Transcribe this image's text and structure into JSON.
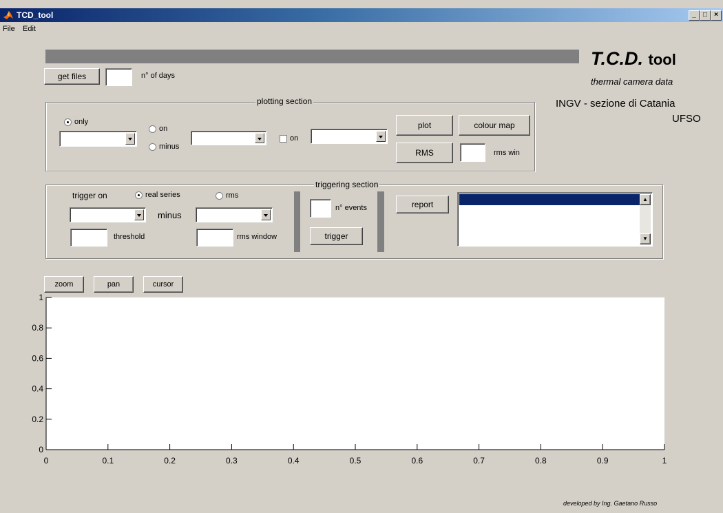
{
  "window": {
    "title": "TCD_tool"
  },
  "menu": {
    "file": "File",
    "edit": "Edit"
  },
  "brand": {
    "name_big": "T.C.D.",
    "name_small": "tool",
    "subtitle": "thermal camera data",
    "institute": "INGV - sezione di Catania",
    "unit": "UFSO",
    "footer": "developed by Ing. Gaetano Russo"
  },
  "files": {
    "get_files_label": "get files",
    "days_label": "n° of days",
    "days_value": ""
  },
  "plotting": {
    "title": "plotting section",
    "only_label": "only",
    "on_label": "on",
    "minus_label": "minus",
    "on2_label": "on",
    "plot_label": "plot",
    "colour_map_label": "colour map",
    "rms_label": "RMS",
    "rms_win_label": "rms win",
    "rms_win_value": ""
  },
  "triggering": {
    "title": "triggering section",
    "trigger_on_label": "trigger on",
    "real_series_label": "real series",
    "rms_label": "rms",
    "minus_label": "minus",
    "threshold_label": "threshold",
    "rms_window_label": "rms window",
    "n_events_label": "n° events",
    "trigger_label": "trigger",
    "report_label": "report"
  },
  "toolbar": {
    "zoom_label": "zoom",
    "pan_label": "pan",
    "cursor_label": "cursor"
  },
  "chart_data": {
    "type": "line",
    "xlim": [
      0,
      1
    ],
    "ylim": [
      0,
      1
    ],
    "x_ticks": [
      "0",
      "0.1",
      "0.2",
      "0.3",
      "0.4",
      "0.5",
      "0.6",
      "0.7",
      "0.8",
      "0.9",
      "1"
    ],
    "y_ticks": [
      "0",
      "0.2",
      "0.4",
      "0.6",
      "0.8",
      "1"
    ],
    "series": [],
    "grid": false
  }
}
